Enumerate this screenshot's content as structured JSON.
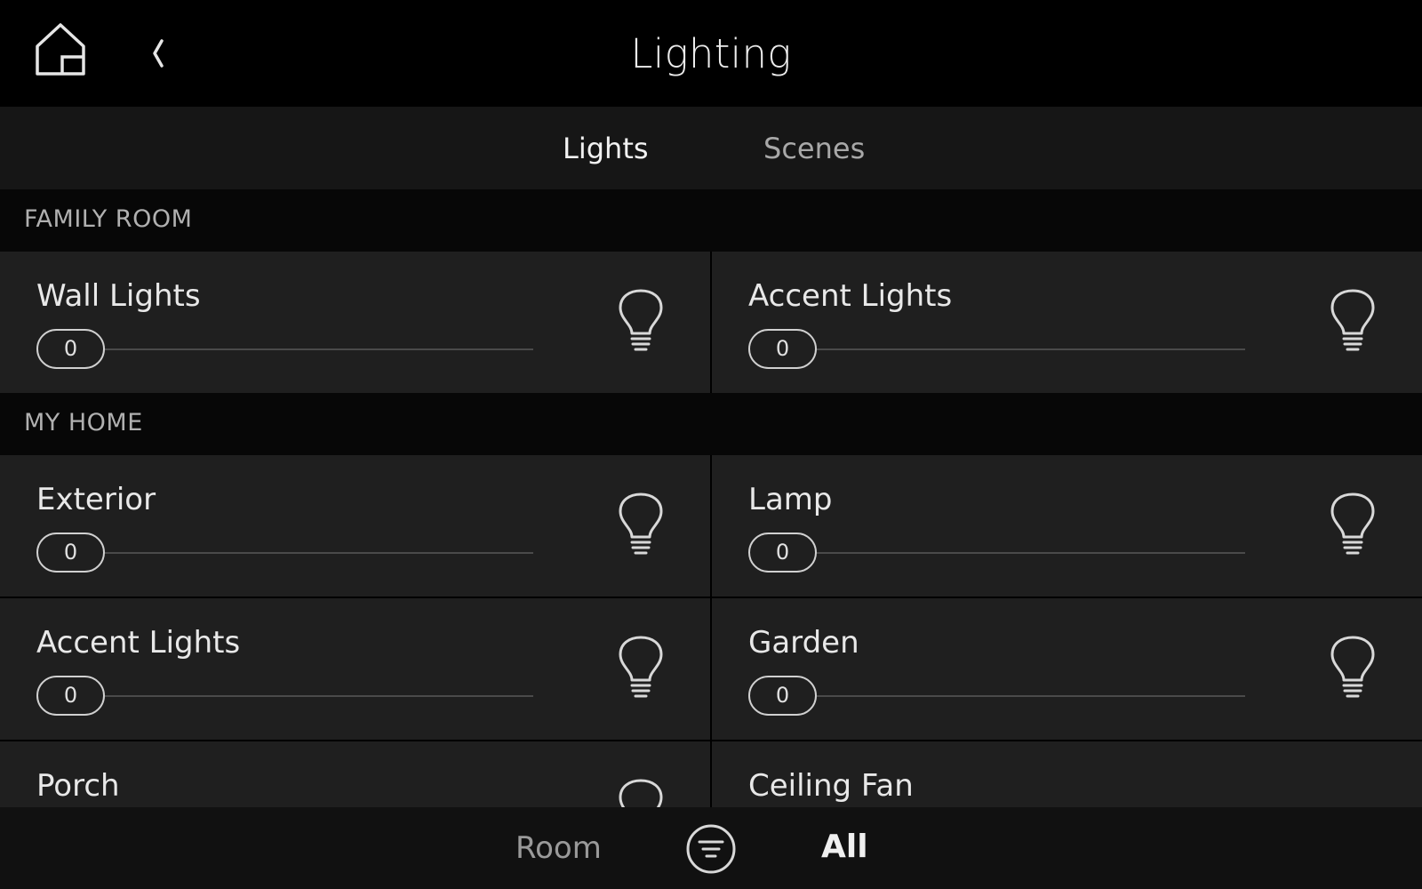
{
  "header": {
    "title": "Lighting",
    "home_icon": "home-icon",
    "back_icon": "chevron-left-icon"
  },
  "tabs": [
    {
      "label": "Lights",
      "active": true
    },
    {
      "label": "Scenes",
      "active": false
    }
  ],
  "sections": [
    {
      "title": "FAMILY ROOM",
      "tiles": [
        {
          "name": "Wall Lights",
          "level": "0",
          "icon": "lightbulb-icon"
        },
        {
          "name": "Accent Lights",
          "level": "0",
          "icon": "lightbulb-icon"
        }
      ]
    },
    {
      "title": "MY HOME",
      "tiles": [
        {
          "name": "Exterior",
          "level": "0",
          "icon": "lightbulb-icon"
        },
        {
          "name": "Lamp",
          "level": "0",
          "icon": "lightbulb-icon"
        },
        {
          "name": "Accent Lights",
          "level": "0",
          "icon": "lightbulb-icon"
        },
        {
          "name": "Garden",
          "level": "0",
          "icon": "lightbulb-icon"
        },
        {
          "name": "Porch",
          "icon": "lightbulb-icon"
        },
        {
          "name": "Ceiling Fan",
          "icon": "ceiling-fan-icon"
        }
      ]
    }
  ],
  "footer": {
    "room_label": "Room",
    "filter_icon": "filter-icon",
    "all_label": "All"
  },
  "colors": {
    "background": "#000000",
    "tile": "#1f1f1f",
    "text": "#e8e8e8",
    "muted": "#9a9a9a"
  }
}
